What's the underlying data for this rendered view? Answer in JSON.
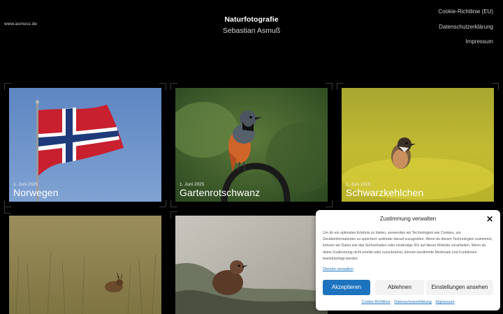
{
  "header": {
    "site_url": "www.asmuss.de",
    "title": "Naturfotografie",
    "subtitle": "Sebastian Asmuß",
    "nav": [
      "Cookie-Richtlinie (EU)",
      "Datenschutzerklärung",
      "Impressum"
    ]
  },
  "gallery": [
    {
      "date": "1. Juni 2025",
      "title": "Norwegen"
    },
    {
      "date": "1. Juni 2025",
      "title": "Gartenrotschwanz"
    },
    {
      "date": "1. Juni 2025",
      "title": "Schwarzkehlchen"
    },
    {
      "date": "",
      "title": ""
    },
    {
      "date": "",
      "title": ""
    }
  ],
  "consent": {
    "title": "Zustimmung verwalten",
    "body": "Um dir ein optimales Erlebnis zu bieten, verwenden wir Technologien wie Cookies, um Geräteinformationen zu speichern und/oder darauf zuzugreifen. Wenn du diesen Technologien zustimmst, können wir Daten wie das Surfverhalten oder eindeutige IDs auf dieser Website verarbeiten. Wenn du deine Zustimmung nicht erteilst oder zurückziehst, können bestimmte Merkmale und Funktionen beeinträchtigt werden.",
    "services_link": "Dienste verwalten",
    "accept": "Akzeptieren",
    "deny": "Ablehnen",
    "settings": "Einstellungen ansehen",
    "footer_links": [
      "Cookie-Richtlinie",
      "Datenschutzerklärung",
      "Impressum"
    ]
  },
  "colors": {
    "background": "#000000",
    "accent": "#1e73be"
  }
}
